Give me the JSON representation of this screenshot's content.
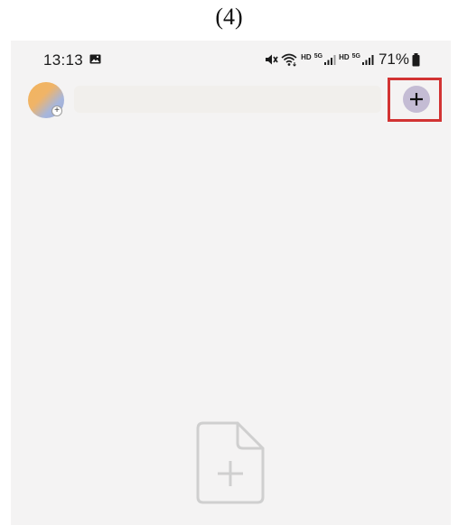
{
  "figure_caption": "(4)",
  "status_bar": {
    "time": "13:13",
    "battery_percent": "71%",
    "net1_label": "HD",
    "net1_type": "5G",
    "net2_label": "HD",
    "net2_type": "5G",
    "icons": [
      "gallery-icon",
      "mute-icon",
      "wifi-icon",
      "signal-icon",
      "signal-icon",
      "battery-icon"
    ]
  },
  "app_bar": {
    "add_button_icon": "plus-icon",
    "highlight_color": "#d23333",
    "add_button_color": "#c4bcd4"
  },
  "empty_state": {
    "icon": "new-document-icon"
  }
}
